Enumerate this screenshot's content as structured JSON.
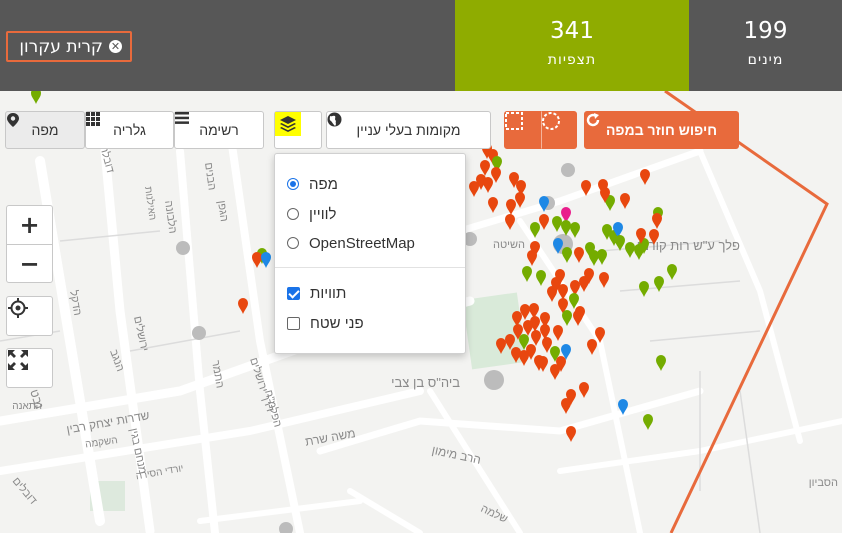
{
  "header": {
    "place": "קרית עקרון",
    "species_count": "199",
    "species_label": "מינים",
    "observations_count": "341",
    "observations_label": "תצפיות"
  },
  "toolbar": {
    "map_label": "מפה",
    "grid_label": "גלריה",
    "list_label": "רשימה",
    "places_label": "מקומות בעלי עניין",
    "redo_search_label": "חיפוש חוזר במפה"
  },
  "layers_menu": {
    "base_layers": [
      "מפה",
      "לוויין",
      "OpenStreetMap"
    ],
    "selected_base": "מפה",
    "overlays": [
      {
        "label": "תוויות",
        "checked": true
      },
      {
        "label": "פני שטח",
        "checked": false
      }
    ]
  },
  "map_labels": [
    "פלך ע\"ש רות קורמן",
    "ביה\"ס בן צבי",
    "השיטה",
    "דובלת",
    "הבנים",
    "הלבונה",
    "הדקל",
    "ירושלים",
    "דרך ירושלים",
    "התמר",
    "הנגב",
    "משה שרת",
    "הרב מימון",
    "שדרות יצחק רבין",
    "נבט",
    "השקמה",
    "הסביון",
    "דובלים",
    "מנחם בגין",
    "כביש החרמון",
    "יורדי הסירה",
    "שלמה",
    "התאנה",
    "הגפן",
    "הפלמ\"ח",
    "האילנות"
  ],
  "colors": {
    "header_bg": "#575757",
    "observations_bg": "#8fac00",
    "accent_orange": "#e86a3c",
    "highlight_yellow": "#ffff00",
    "marker_orange": "#e8470f",
    "marker_green": "#74ac00",
    "marker_blue": "#1e88e5",
    "marker_pink": "#e91e8c"
  },
  "icons": [
    "close-circle-icon",
    "map-marker-icon",
    "grid-icon",
    "list-icon",
    "layers-icon",
    "globe-icon",
    "rectangle-select-icon",
    "circle-select-icon",
    "refresh-icon",
    "zoom-in-icon",
    "zoom-out-icon",
    "locate-icon",
    "fullscreen-icon"
  ]
}
